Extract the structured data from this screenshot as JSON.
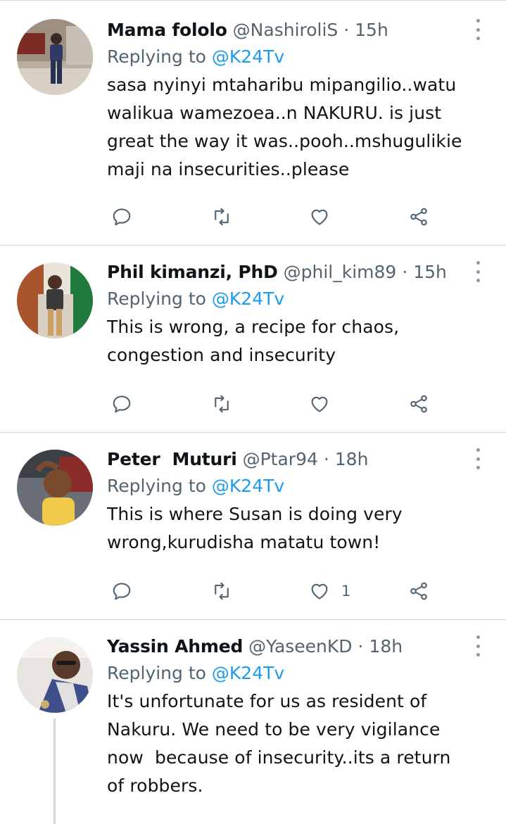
{
  "tweets": [
    {
      "name": "Mama fololo",
      "handle": "@NashiroliS",
      "separator": "·",
      "time": "15h",
      "replying_prefix": "Replying to",
      "replying_to": "@K24Tv",
      "lines": [
        "sasa nyinyi mtaharibu mipangilio..watu",
        "walikua wamezoea..n NAKURU. is just",
        "great the way it was..pooh..mshugulikie",
        "maji na insecurities..please"
      ],
      "like_count": "",
      "icons": [
        "reply-icon",
        "retweet-icon",
        "like-icon",
        "share-icon",
        "more-icon"
      ]
    },
    {
      "name": "Phil kimanzi, PhD",
      "handle": "@phil_kim89",
      "separator": "·",
      "time": "15h",
      "replying_prefix": "Replying to",
      "replying_to": "@K24Tv",
      "lines": [
        "This is wrong, a recipe for chaos,",
        "congestion and insecurity"
      ],
      "like_count": "",
      "icons": [
        "reply-icon",
        "retweet-icon",
        "like-icon",
        "share-icon",
        "more-icon"
      ]
    },
    {
      "name": "Peter  Muturi",
      "handle": "@Ptar94",
      "separator": "·",
      "time": "18h",
      "replying_prefix": "Replying to",
      "replying_to": "@K24Tv",
      "lines": [
        "This is where Susan is doing very",
        "wrong,kurudisha matatu town!"
      ],
      "like_count": "1",
      "icons": [
        "reply-icon",
        "retweet-icon",
        "like-icon",
        "share-icon",
        "more-icon"
      ]
    },
    {
      "name": "Yassin Ahmed",
      "handle": "@YaseenKD",
      "separator": "·",
      "time": "18h",
      "replying_prefix": "Replying to",
      "replying_to": "@K24Tv",
      "lines": [
        "It's unfortunate for us as resident of",
        "Nakuru. We need to be very vigilance",
        "now  because of insecurity..its a return",
        "of robbers."
      ],
      "like_count": "",
      "icons": [
        "reply-icon",
        "retweet-icon",
        "like-icon",
        "share-icon",
        "more-icon"
      ]
    }
  ],
  "colors": {
    "text": "#0f1419",
    "secondary": "#536471",
    "mention": "#1d9bf0",
    "divider": "#cfd9de"
  }
}
